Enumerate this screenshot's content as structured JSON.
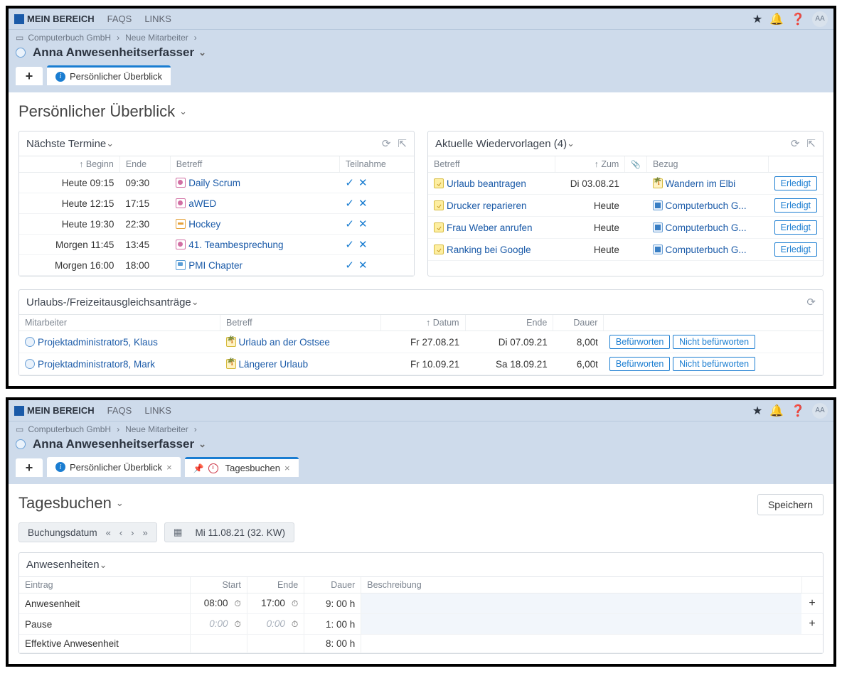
{
  "topbar": {
    "nav": {
      "myarea": "MEIN BEREICH",
      "faqs": "FAQS",
      "links": "LINKS"
    },
    "avatar": "AA"
  },
  "crumbs": {
    "c1": "Computerbuch GmbH",
    "c2": "Neue Mitarbeiter"
  },
  "person_title": "Anna Anwesenheitserfasser",
  "shot1": {
    "tab1": "Persönlicher Überblick",
    "page_title": "Persönlicher Überblick",
    "termine": {
      "title": "Nächste Termine",
      "cols": {
        "beginn": "Beginn",
        "ende": "Ende",
        "betreff": "Betreff",
        "teilnahme": "Teilnahme"
      },
      "rows": [
        {
          "beginn": "Heute 09:15",
          "ende": "09:30",
          "betreff": "Daily Scrum",
          "icon": "scrum"
        },
        {
          "beginn": "Heute 12:15",
          "ende": "17:15",
          "betreff": "aWED",
          "icon": "scrum"
        },
        {
          "beginn": "Heute 19:30",
          "ende": "22:30",
          "betreff": "Hockey",
          "icon": "hockey"
        },
        {
          "beginn": "Morgen 11:45",
          "ende": "13:45",
          "betreff": "41. Teambesprechung",
          "icon": "scrum"
        },
        {
          "beginn": "Morgen 16:00",
          "ende": "18:00",
          "betreff": "PMI Chapter",
          "icon": "chat"
        }
      ]
    },
    "wv": {
      "title": "Aktuelle Wiedervorlagen (4)",
      "cols": {
        "betreff": "Betreff",
        "zum": "Zum",
        "bezug": "Bezug"
      },
      "done": "Erledigt",
      "rows": [
        {
          "betreff": "Urlaub beantragen",
          "zum": "Di 03.08.21",
          "bezug": "Wandern im Elbi",
          "bicon": "palm"
        },
        {
          "betreff": "Drucker reparieren",
          "zum": "Heute",
          "bezug": "Computerbuch G...",
          "bicon": "building"
        },
        {
          "betreff": "Frau Weber anrufen",
          "zum": "Heute",
          "bezug": "Computerbuch G...",
          "bicon": "building"
        },
        {
          "betreff": "Ranking bei Google",
          "zum": "Heute",
          "bezug": "Computerbuch G...",
          "bicon": "building"
        }
      ]
    },
    "urlaub": {
      "title": "Urlaubs-/Freizeitausgleichsanträge",
      "cols": {
        "ma": "Mitarbeiter",
        "betreff": "Betreff",
        "datum": "Datum",
        "ende": "Ende",
        "dauer": "Dauer"
      },
      "approve": "Befürworten",
      "reject": "Nicht befürworten",
      "rows": [
        {
          "ma": "Projektadministrator5, Klaus",
          "betreff": "Urlaub an der Ostsee",
          "datum": "Fr 27.08.21",
          "ende": "Di 07.09.21",
          "dauer": "8,00t"
        },
        {
          "ma": "Projektadministrator8, Mark",
          "betreff": "Längerer Urlaub",
          "datum": "Fr 10.09.21",
          "ende": "Sa 18.09.21",
          "dauer": "6,00t"
        }
      ]
    }
  },
  "shot2": {
    "tab1": "Persönlicher Überblick",
    "tab2": "Tagesbuchen",
    "page_title": "Tagesbuchen",
    "save": "Speichern",
    "date_label": "Buchungsdatum",
    "date_value": "Mi 11.08.21 (32. KW)",
    "anw": {
      "title": "Anwesenheiten",
      "cols": {
        "eintrag": "Eintrag",
        "start": "Start",
        "ende": "Ende",
        "dauer": "Dauer",
        "besch": "Beschreibung"
      },
      "rows": [
        {
          "eintrag": "Anwesenheit",
          "sh": "08:",
          "sm": "00",
          "eh": "17:",
          "em": "00",
          "dauer": "9: 00 h",
          "dim": false,
          "plus": true,
          "desc": true
        },
        {
          "eintrag": "Pause",
          "sh": "0:",
          "sm": "00",
          "eh": "0:",
          "em": "00",
          "dauer": "1: 00 h",
          "dim": true,
          "plus": true,
          "desc": true
        },
        {
          "eintrag": "Effektive Anwesenheit",
          "sh": "",
          "sm": "",
          "eh": "",
          "em": "",
          "dauer": "8: 00 h",
          "dim": false,
          "plus": false,
          "desc": false
        }
      ]
    }
  }
}
